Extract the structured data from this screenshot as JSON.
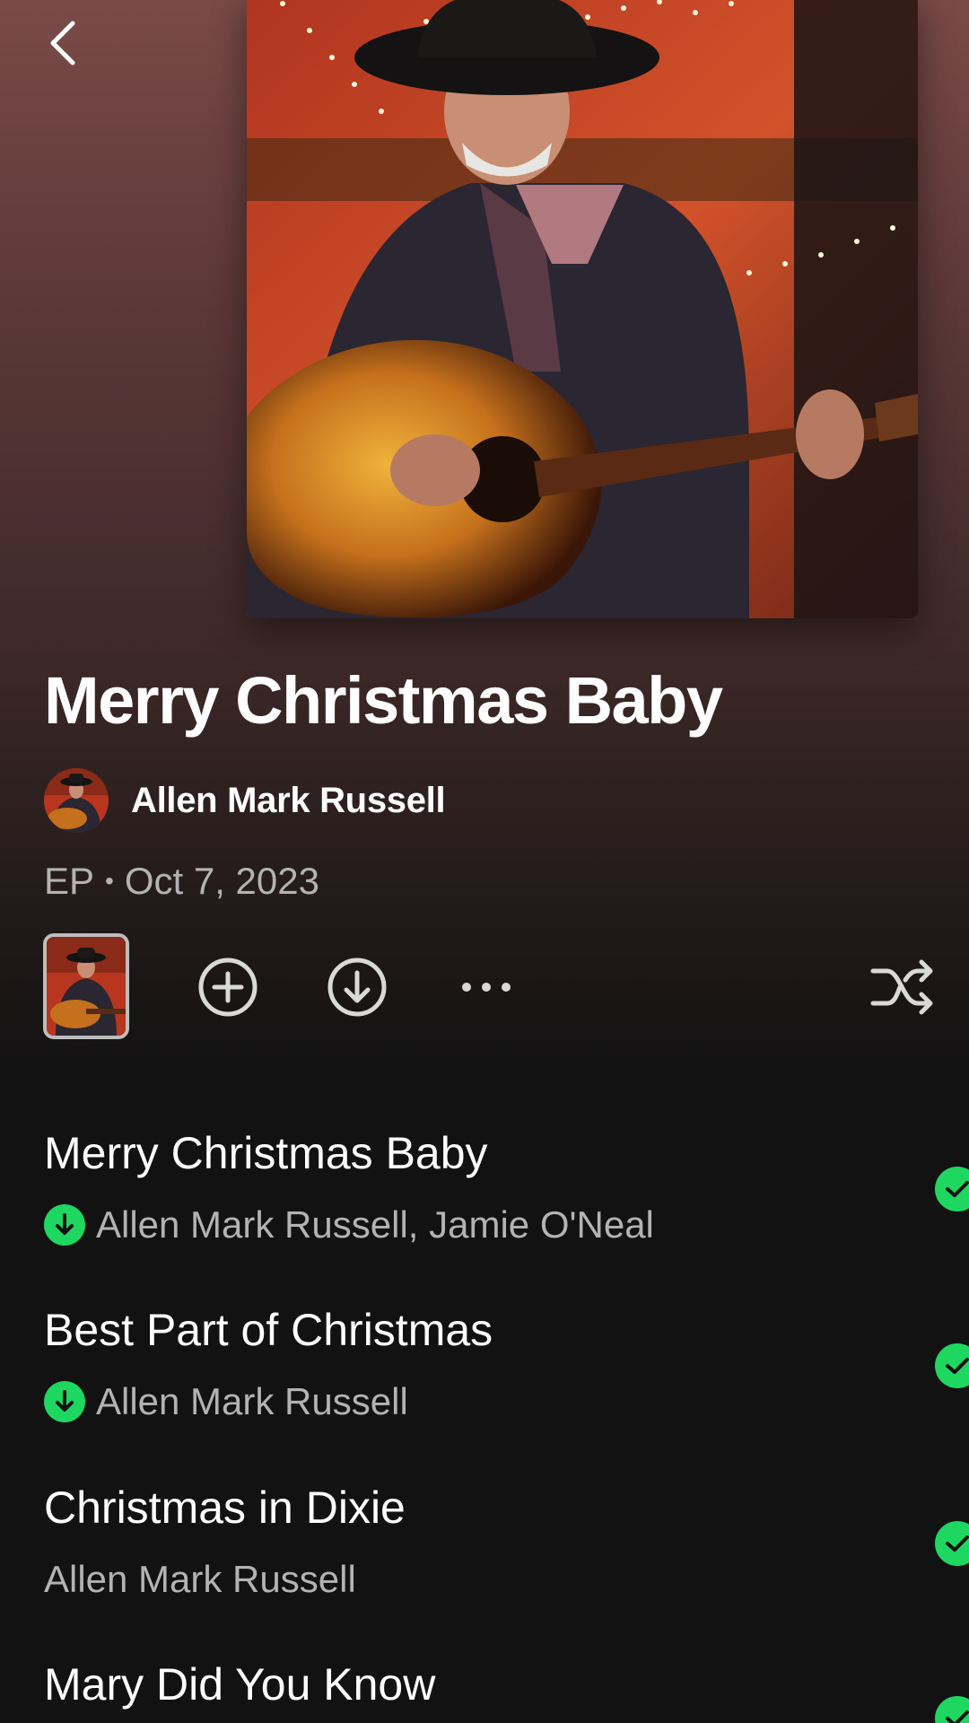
{
  "header": {
    "back_icon": "chevron-left-icon"
  },
  "album": {
    "title": "Merry Christmas Baby",
    "artist": "Allen Mark Russell",
    "type": "EP",
    "separator": "•",
    "release_date": "Oct 7, 2023",
    "cover_icon": "album-cover-image"
  },
  "actions": {
    "add_icon": "plus-circle-icon",
    "download_icon": "download-circle-icon",
    "more_icon": "more-horizontal-icon",
    "shuffle_icon": "shuffle-icon"
  },
  "tracks": [
    {
      "title": "Merry Christmas Baby",
      "artists": "Allen Mark Russell, Jamie O'Neal",
      "downloaded": true,
      "saved": true
    },
    {
      "title": "Best Part of Christmas",
      "artists": "Allen Mark Russell",
      "downloaded": true,
      "saved": true
    },
    {
      "title": "Christmas in Dixie",
      "artists": "Allen Mark Russell",
      "downloaded": false,
      "saved": true
    },
    {
      "title": "Mary Did You Know",
      "artists": "",
      "downloaded": false,
      "saved": true
    }
  ],
  "colors": {
    "accent": "#1ed760",
    "background": "#121212",
    "secondary_text": "#b3b3b3",
    "header_gradient": "#7a4a48"
  }
}
